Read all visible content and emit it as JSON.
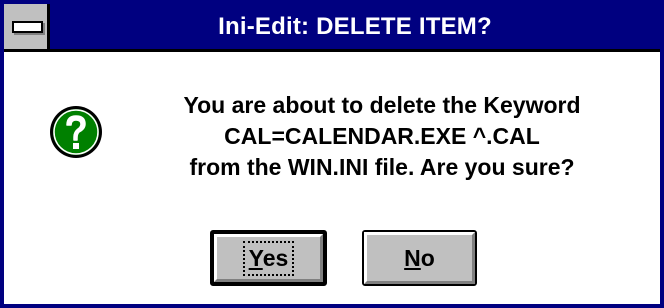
{
  "window": {
    "title": "Ini-Edit: DELETE ITEM?"
  },
  "icon": {
    "name": "question-icon",
    "glyph": "?",
    "color": "#008000"
  },
  "message": {
    "line1": "You are about to delete the Keyword",
    "line2": "CAL=CALENDAR.EXE ^.CAL",
    "line3": "from the WIN.INI file.  Are you sure?"
  },
  "buttons": {
    "yes": {
      "accel": "Y",
      "rest": "es"
    },
    "no": {
      "accel": "N",
      "rest": "o"
    }
  },
  "colors": {
    "titlebar": "#000080",
    "button_face": "#c0c0c0",
    "icon_green": "#008000"
  }
}
